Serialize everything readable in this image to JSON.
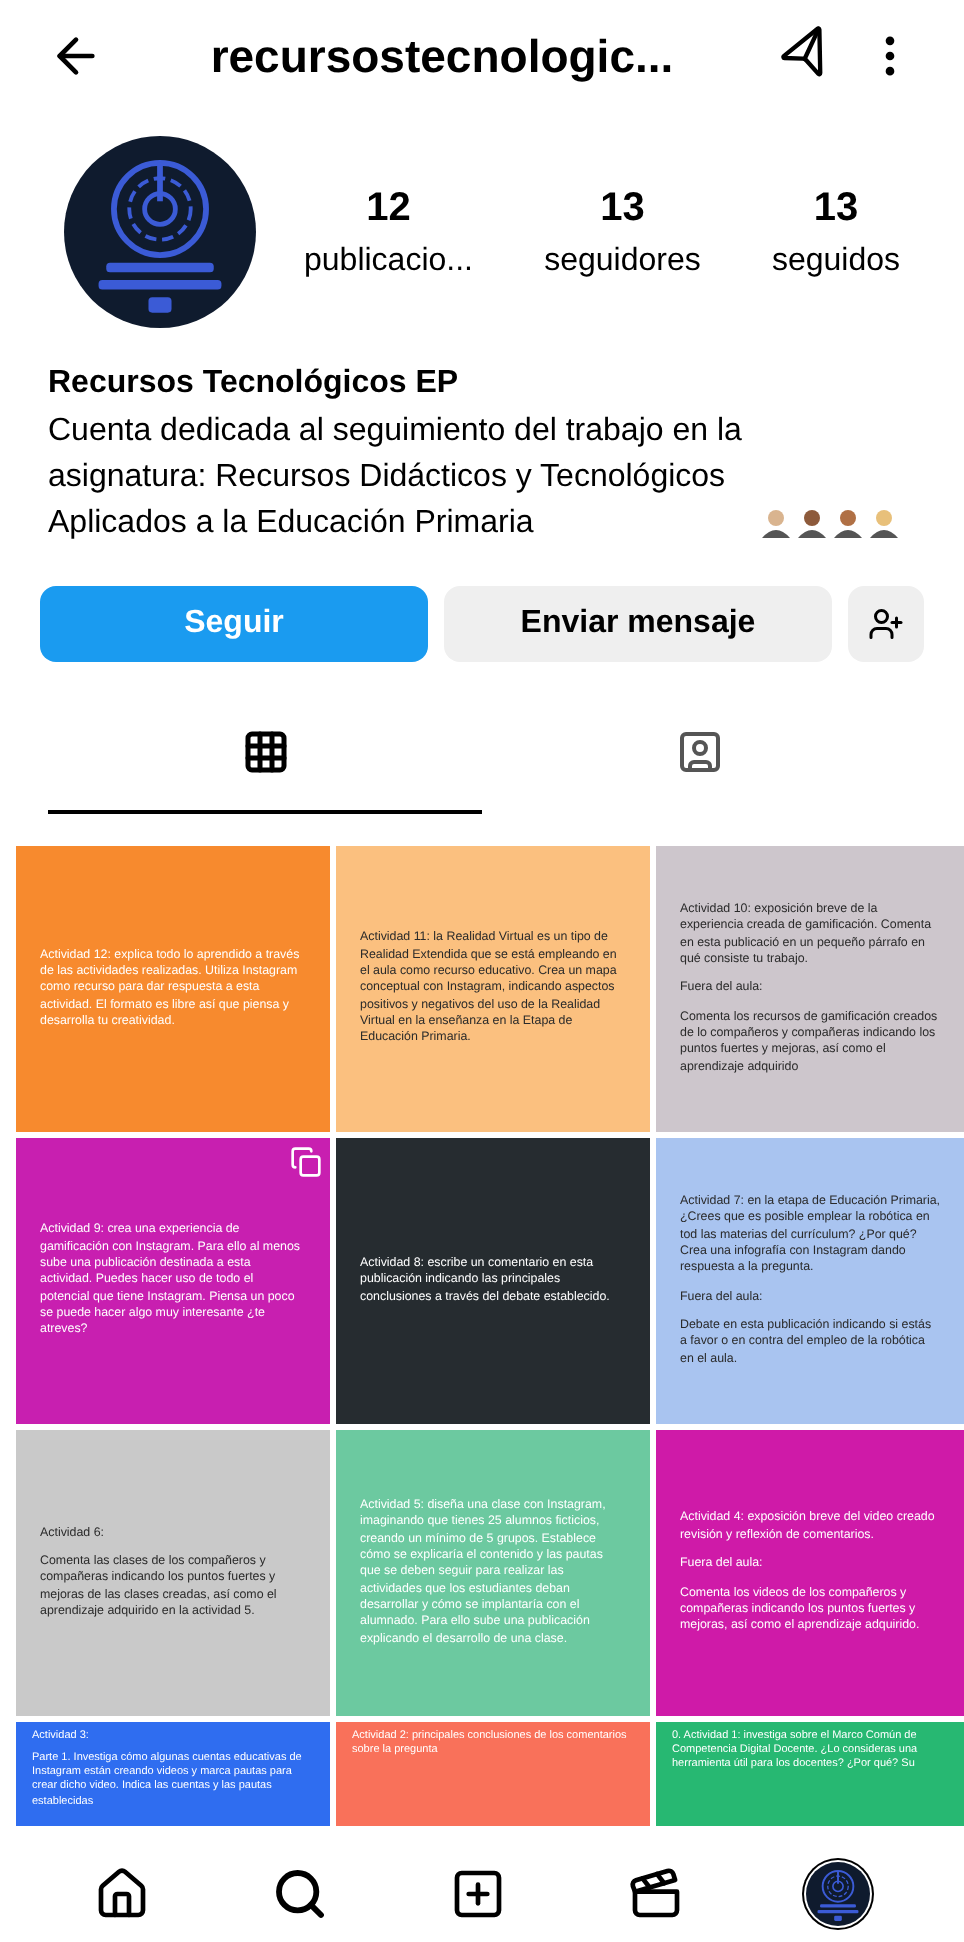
{
  "header": {
    "username": "recursostecnologic..."
  },
  "profile": {
    "stats": [
      {
        "value": "12",
        "label": "publicacio..."
      },
      {
        "value": "13",
        "label": "seguidores"
      },
      {
        "value": "13",
        "label": "seguidos"
      }
    ],
    "name": "Recursos Tecnológicos EP",
    "bio": "Cuenta dedicada al seguimiento del trabajo en la asignatura: Recursos Didácticos y Tecnológicos Aplicados a la Educación Primaria"
  },
  "buttons": [
    {
      "label": "Seguir",
      "kind": "primary"
    },
    {
      "label": "Enviar mensaje",
      "kind": "secondary"
    }
  ],
  "tabs": [
    {
      "kind": "grid",
      "selected": true
    },
    {
      "kind": "tagged",
      "selected": false
    }
  ],
  "posts": [
    {
      "color": "#f78a2e",
      "multiple": false,
      "paragraphs": [
        "Actividad 12: explica todo lo aprendido a través de las actividades realizadas. Utiliza Instagram como recurso para dar respuesta a esta actividad. El formato es libre así que piensa y desarrolla tu creatividad."
      ]
    },
    {
      "color": "#fbc07f",
      "multiple": false,
      "paragraphs": [
        "Actividad 11: la Realidad Virtual es un tipo de Realidad Extendida que se está empleando en el aula como recurso educativo. Crea un mapa conceptual con Instagram, indicando aspectos positivos y negativos del uso de la Realidad Virtual en la enseñanza en la Etapa de Educación Primaria."
      ]
    },
    {
      "color": "#cdc6cc",
      "multiple": false,
      "paragraphs": [
        "Actividad 10: exposición breve de la experiencia creada de gamificación. Comenta en esta publicació en un pequeño párrafo en qué consiste tu trabajo.",
        "Fuera del aula:",
        "Comenta los recursos de gamificación creados de lo compañeros y compañeras indicando los puntos fuertes y mejoras, así como el aprendizaje adquirido"
      ]
    },
    {
      "color": "#c81fb0",
      "multiple": true,
      "paragraphs": [
        "Actividad 9: crea una experiencia de gamificación con Instagram. Para ello al menos sube una publicación destinada a esta actividad. Puedes hacer uso de todo el potencial que tiene Instagram.  Piensa un poco se puede hacer algo muy interesante ¿te atreves?"
      ]
    },
    {
      "color": "#262c30",
      "multiple": false,
      "paragraphs": [
        "Actividad 8: escribe un comentario en esta publicación indicando las principales conclusiones a través del debate establecido."
      ]
    },
    {
      "color": "#a9c4f0",
      "multiple": false,
      "paragraphs": [
        "Actividad 7: en la etapa de Educación Primaria, ¿Crees que es posible emplear la robótica en tod las materias del currículum? ¿Por qué? Crea una infografía con Instagram dando respuesta a la pregunta.",
        "Fuera del aula:",
        "Debate en esta publicación indicando si estás a favor o en contra del empleo de la robótica en el aula."
      ]
    },
    {
      "color": "#c9c9c9",
      "multiple": false,
      "paragraphs": [
        "Actividad 6:",
        "Comenta las clases de los compañeros y compañeras indicando los puntos fuertes y mejoras de las clases creadas, así como el aprendizaje adquirido en la actividad 5."
      ]
    },
    {
      "color": "#6cc9a0",
      "multiple": false,
      "paragraphs": [
        "Actividad 5: diseña una clase con Instagram, imaginando que tienes 25 alumnos ficticios, creando un mínimo de 5 grupos. Establece cómo se explicaría el contenido y las pautas que se deben seguir para realizar las actividades que los estudiantes deban desarrollar y cómo se implantaría con el alumnado. Para ello sube una publicación explicando el desarrollo de una clase."
      ]
    },
    {
      "color": "#cf1aa8",
      "multiple": false,
      "paragraphs": [
        "Actividad 4: exposición breve del video creado revisión y reflexión de comentarios.",
        "Fuera del aula:",
        "Comenta los videos de los compañeros y compañeras indicando los puntos fuertes y mejoras, así como el aprendizaje adquirido."
      ]
    },
    {
      "color": "#2f6df0",
      "multiple": false,
      "paragraphs": [
        "Actividad 3:",
        "Parte 1. Investiga cómo algunas cuentas educativas de Instagram están creando videos y marca pautas para crear dicho video. Indica las cuentas y las pautas establecidas"
      ]
    },
    {
      "color": "#f9715a",
      "multiple": false,
      "paragraphs": [
        "Actividad 2: principales conclusiones de los comentarios sobre la pregunta"
      ]
    },
    {
      "color": "#27b872",
      "multiple": false,
      "paragraphs": [
        "0. Actividad 1: investiga sobre el Marco Común de Competencia Digital Docente. ¿Lo consideras una herramienta útil para los docentes? ¿Por qué? Su"
      ]
    }
  ],
  "bottom_nav": [
    {
      "kind": "home",
      "selected": false
    },
    {
      "kind": "search",
      "selected": false
    },
    {
      "kind": "create",
      "selected": false
    },
    {
      "kind": "reels",
      "selected": false
    },
    {
      "kind": "profile",
      "selected": true
    }
  ]
}
